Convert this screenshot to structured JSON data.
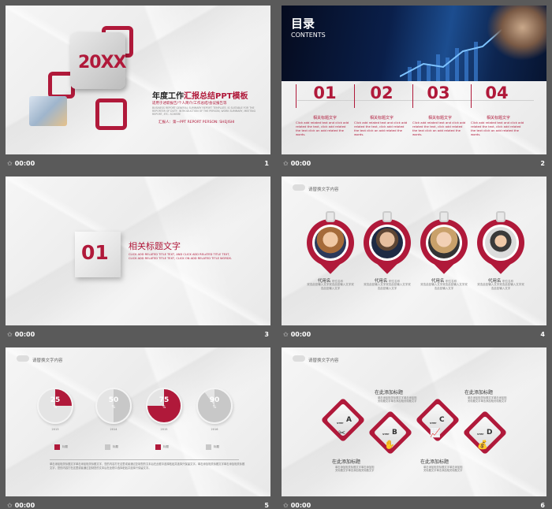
{
  "slides": [
    {
      "number": "1",
      "time": "00:00",
      "year": "20XX",
      "title_prefix": "年度工作",
      "title_highlight": "汇报总结PPT模板",
      "subtitle": "适用于述职报告/个人简介/工作总结/会议报告等",
      "english": "BUSINESS REPORT GENERAL SUMMARY REPORT TEMPLATE. IS SUITABLE FOR THE REPORTER OF DUTY, INTRODUCTION OF THE PERSON, WORK SUMMARY, MEETING REPORT, ETC. SCHEME",
      "reporter": "汇报人：第一PPT  REPORT PERSON: SHEJISHI"
    },
    {
      "number": "2",
      "time": "00:00",
      "heading": "目录",
      "heading_en": "CONTENTS",
      "items": [
        {
          "num": "01",
          "title": "相关标题文字",
          "text": "Click add related text and click add related the text, click add related the text click on add related the words."
        },
        {
          "num": "02",
          "title": "相关标题文字",
          "text": "Click add related text and click add related the text, click add related the text click on add related the words."
        },
        {
          "num": "03",
          "title": "相关标题文字",
          "text": "Click add related text and click add related the text, click add related the text click on add related the words."
        },
        {
          "num": "04",
          "title": "相关标题文字",
          "text": "Click add related text and click add related the text, click add related the text click on add related the words."
        }
      ]
    },
    {
      "number": "3",
      "time": "00:00",
      "num": "01",
      "title": "相关标题文字",
      "english": "CLICK ADD RELATED TITLE TEXT, AND CLICK ADD RELATED TITLE TEXT, CLICK ADD RELATED TITLE TEXT, CLICK ON ADD RELATED TITLE WORDS."
    },
    {
      "number": "4",
      "time": "00:00",
      "header": "请替换文字内容",
      "people": [
        {
          "name": "代用名",
          "role": "职位名称",
          "desc": "双击此处输入文字双击此处输入文字双击此处输入文字"
        },
        {
          "name": "代用名",
          "role": "职位名称",
          "desc": "双击此处输入文字双击此处输入文字双击此处输入文字"
        },
        {
          "name": "代用名",
          "role": "职位名称",
          "desc": "双击此处输入文字双击此处输入文字双击此处输入文字"
        },
        {
          "name": "代用名",
          "role": "职位名称",
          "desc": "双击此处输入文字双击此处输入文字双击此处输入文字"
        }
      ]
    },
    {
      "number": "5",
      "time": "00:00",
      "header": "请替换文字内容",
      "pies": [
        {
          "value": "25",
          "pct": "%",
          "year": "2013",
          "color": "#b0193a",
          "fill": 0.25
        },
        {
          "value": "50",
          "pct": "%",
          "year": "2014",
          "color": "#c8c8c8",
          "fill": 0.5
        },
        {
          "value": "75",
          "pct": "%",
          "year": "2015",
          "color": "#b0193a",
          "fill": 0.75
        },
        {
          "value": "90",
          "pct": "%",
          "year": "2016",
          "color": "#c8c8c8",
          "fill": 0.9
        }
      ],
      "legend": [
        {
          "label": "标题",
          "color": "#b0193a"
        },
        {
          "label": "标题",
          "color": "#c8c8c8"
        },
        {
          "label": "标题",
          "color": "#b0193a"
        },
        {
          "label": "标题",
          "color": "#c8c8c8"
        }
      ],
      "paragraph": "单击添加相关标题文字单击添加相关标题文字，您的内容打在这里或者通过复制您的文本后在此框中选择粘贴并选择只保留文字。单击添加相关标题文字单击添加相关标题文字，您的内容打在这里或者通过复制您的文本后在此框中选择粘贴并选择只保留文字。"
    },
    {
      "number": "6",
      "time": "00:00",
      "header": "请替换文字内容",
      "steps": [
        {
          "label": "STEP",
          "letter": "A",
          "icon": "scissors-icon",
          "glyph": "✂"
        },
        {
          "label": "STEP",
          "letter": "B",
          "icon": "handshake-icon",
          "glyph": "✋"
        },
        {
          "label": "STEP",
          "letter": "C",
          "icon": "growth-chart-icon",
          "glyph": "📈"
        },
        {
          "label": "STEP",
          "letter": "D",
          "icon": "money-bag-icon",
          "glyph": "💰"
        }
      ],
      "captions": [
        {
          "title": "在此添加标题",
          "text": "单击添加相关标题文字单击添加相关标题文字单击添加相关标题文字"
        },
        {
          "title": "在此添加标题",
          "text": "单击添加相关标题文字单击添加相关标题文字单击添加相关标题文字"
        },
        {
          "title": "在此添加标题",
          "text": "单击添加相关标题文字单击添加相关标题文字单击添加相关标题文字"
        },
        {
          "title": "在此添加标题",
          "text": "单击添加相关标题文字单击添加相关标题文字单击添加相关标题文字"
        }
      ]
    }
  ]
}
